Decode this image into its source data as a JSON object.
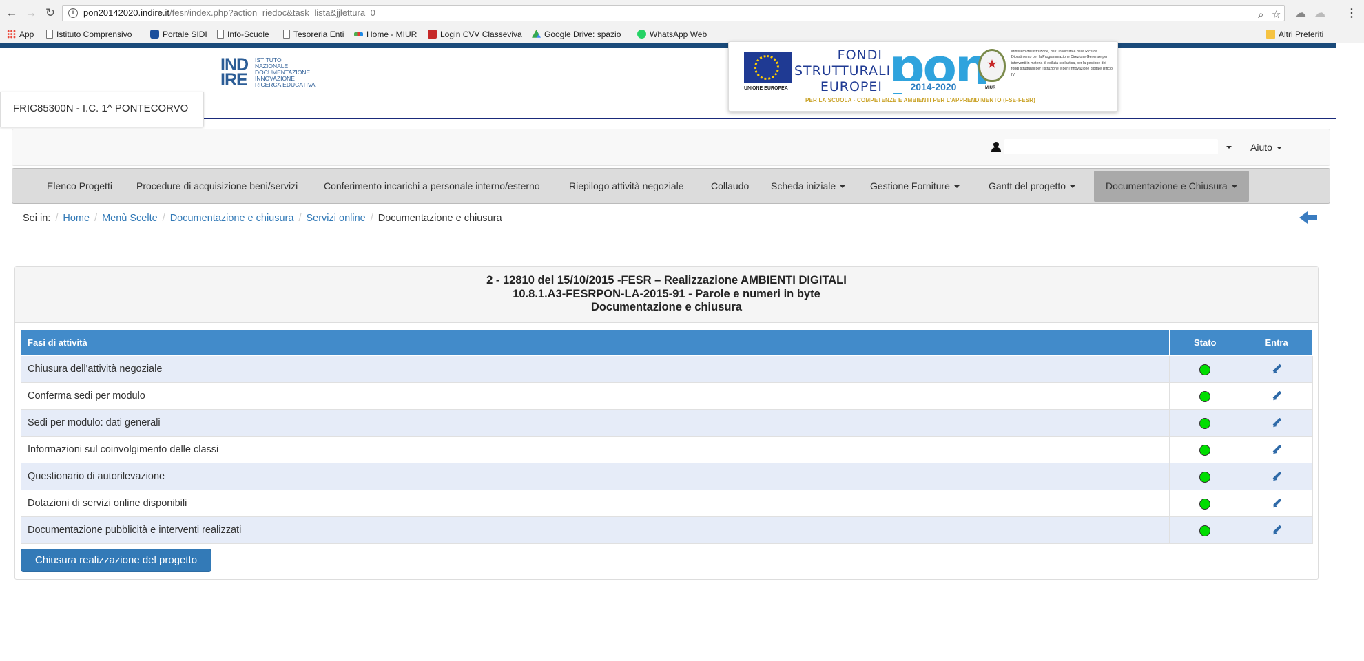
{
  "browser": {
    "url_host": "pon20142020.indire.it",
    "url_path": "/fesr/index.php?action=riedoc&task=lista&jjlettura=0",
    "bookmarks": [
      {
        "label": "App",
        "icon": "apps-grid-icon"
      },
      {
        "label": "Istituto Comprensivo",
        "icon": "page-icon"
      },
      {
        "label": "Portale SIDI",
        "icon": "sidi-icon"
      },
      {
        "label": "Info-Scuole",
        "icon": "page-icon"
      },
      {
        "label": "Tesoreria Enti",
        "icon": "page-icon"
      },
      {
        "label": "Home - MIUR",
        "icon": "miur-icon"
      },
      {
        "label": "Login CVV Classeviva",
        "icon": "cvv-icon"
      },
      {
        "label": "Google Drive: spazio",
        "icon": "drive-icon"
      },
      {
        "label": "WhatsApp Web",
        "icon": "whatsapp-icon"
      }
    ],
    "other_bookmarks": "Altri Preferiti"
  },
  "header": {
    "logo_big_1": "IND",
    "logo_big_2": "IRE",
    "logo_small": [
      "ISTITUTO",
      "NAZIONALE",
      "DOCUMENTAZIONE",
      "INNOVAZIONE",
      "RICERCA EDUCATIVA"
    ],
    "school": "FRIC85300N - I.C. 1^ PONTECORVO",
    "banner": {
      "eu_label": "UNIONE EUROPEA",
      "fondi": [
        "FONDI",
        "STRUTTURALI",
        "EUROPEI"
      ],
      "pon": "pon",
      "years": "2014-2020",
      "miur_label": "MIUR",
      "ministry": "Ministero dell'Istruzione, dell'Università e della Ricerca Dipartimento per la Programmazione Direzione Generale per interventi in materia di edilizia scolastica, per la gestione dei fondi strutturali per l'istruzione e per l'innovazione digitale Ufficio IV",
      "caption": "PER LA SCUOLA - COMPETENZE E AMBIENTI PER L'APPRENDIMENTO (FSE-FESR)"
    }
  },
  "user_bar": {
    "user_value": "",
    "help": "Aiuto"
  },
  "menu": [
    {
      "label": "Elenco Progetti",
      "dropdown": false
    },
    {
      "label": "Procedure di acquisizione beni/servizi",
      "dropdown": false
    },
    {
      "label": "Conferimento incarichi a personale interno/esterno",
      "dropdown": false
    },
    {
      "label": "Riepilogo attività negoziale",
      "dropdown": false
    },
    {
      "label": "Collaudo",
      "dropdown": false
    },
    {
      "label": "Scheda iniziale",
      "dropdown": true
    },
    {
      "label": "Gestione Forniture",
      "dropdown": true
    },
    {
      "label": "Gantt del progetto",
      "dropdown": true
    },
    {
      "label": "Documentazione e Chiusura",
      "dropdown": true,
      "active": true
    }
  ],
  "breadcrumb": {
    "prefix": "Sei in:",
    "links": [
      "Home",
      "Menù Scelte",
      "Documentazione e chiusura",
      "Servizi online"
    ],
    "current": "Documentazione e chiusura"
  },
  "panel": {
    "title_line1": "2 - 12810 del 15/10/2015 -FESR – Realizzazione AMBIENTI DIGITALI",
    "title_line2": "10.8.1.A3-FESRPON-LA-2015-91 - Parole e numeri in byte",
    "title_line3": "Documentazione e chiusura",
    "columns": [
      "Fasi di attività",
      "Stato",
      "Entra"
    ],
    "rows": [
      {
        "fase": "Chiusura dell'attività negoziale",
        "stato": "completato",
        "stato_color": "#00dd00"
      },
      {
        "fase": "Conferma sedi per modulo",
        "stato": "completato",
        "stato_color": "#00dd00"
      },
      {
        "fase": "Sedi per modulo: dati generali",
        "stato": "completato",
        "stato_color": "#00dd00"
      },
      {
        "fase": "Informazioni sul coinvolgimento delle classi",
        "stato": "completato",
        "stato_color": "#00dd00"
      },
      {
        "fase": "Questionario di autorilevazione",
        "stato": "completato",
        "stato_color": "#00dd00"
      },
      {
        "fase": "Dotazioni di servizi online disponibili",
        "stato": "completato",
        "stato_color": "#00dd00"
      },
      {
        "fase": "Documentazione pubblicità e interventi realizzati",
        "stato": "completato",
        "stato_color": "#00dd00"
      }
    ],
    "button": "Chiusura realizzazione del progetto"
  },
  "colors": {
    "table_header": "#428bca",
    "row_alt": "#e6ecf8",
    "primary_button": "#337ab7",
    "header_bar": "#1a4a7a"
  }
}
